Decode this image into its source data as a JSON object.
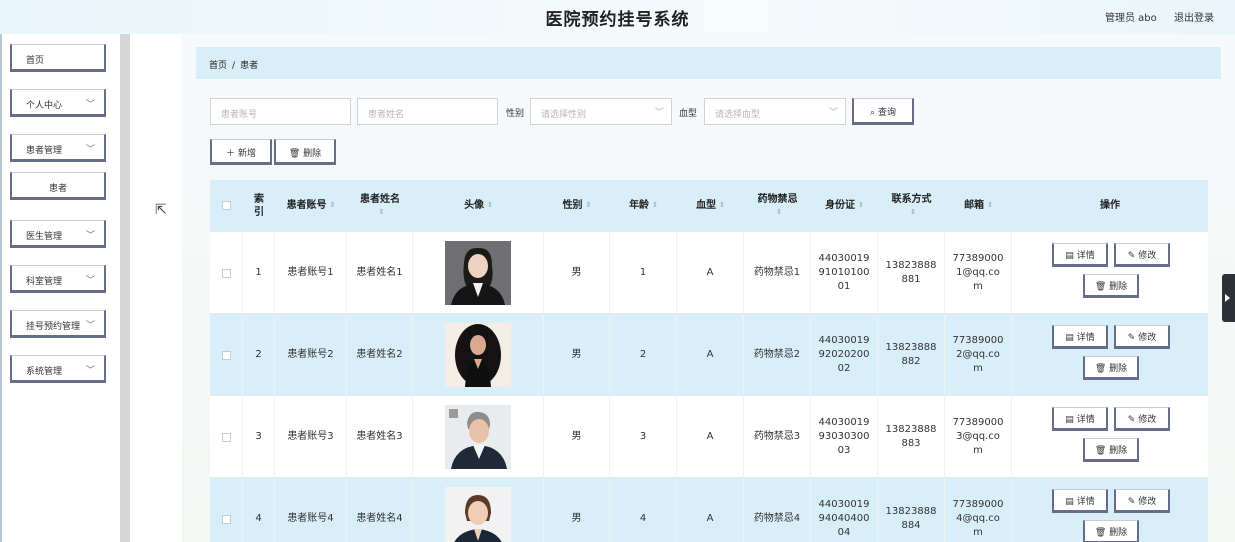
{
  "header": {
    "title": "医院预约挂号系统",
    "user": "管理员 abo",
    "logout": "退出登录"
  },
  "sidebar": {
    "items": [
      {
        "label": "首页"
      },
      {
        "label": "个人中心"
      },
      {
        "label": "患者管理"
      },
      {
        "label": "患者"
      },
      {
        "label": "医生管理"
      },
      {
        "label": "科室管理"
      },
      {
        "label": "挂号预约管理"
      },
      {
        "label": "系统管理"
      }
    ]
  },
  "breadcrumb": {
    "home": "首页",
    "sep": "/",
    "current": "患者"
  },
  "search": {
    "account_placeholder": "患者账号",
    "name_placeholder": "患者姓名",
    "gender_label": "性别",
    "gender_placeholder": "请选择性别",
    "blood_label": "血型",
    "blood_placeholder": "请选择血型",
    "query": "查询"
  },
  "actions": {
    "add": "新增",
    "delete": "删除"
  },
  "table": {
    "headers": {
      "index": "索引",
      "account": "患者账号",
      "name": "患者姓名",
      "avatar": "头像",
      "gender": "性别",
      "age": "年龄",
      "blood": "血型",
      "allergy": "药物禁忌",
      "idcard": "身份证",
      "phone": "联系方式",
      "email": "邮箱",
      "ops": "操作"
    },
    "ops": {
      "detail": "详情",
      "edit": "修改",
      "delete": "删除"
    },
    "rows": [
      {
        "index": "1",
        "account": "患者账号1",
        "name": "患者姓名1",
        "gender": "男",
        "age": "1",
        "blood": "A",
        "allergy": "药物禁忌1",
        "id1": "44030019",
        "id2": "91010100",
        "id3": "01",
        "ph1": "13823888",
        "ph2": "881",
        "em1": "77389000",
        "em2": "1@qq.co",
        "em3": "m"
      },
      {
        "index": "2",
        "account": "患者账号2",
        "name": "患者姓名2",
        "gender": "男",
        "age": "2",
        "blood": "A",
        "allergy": "药物禁忌2",
        "id1": "44030019",
        "id2": "92020200",
        "id3": "02",
        "ph1": "13823888",
        "ph2": "882",
        "em1": "77389000",
        "em2": "2@qq.co",
        "em3": "m"
      },
      {
        "index": "3",
        "account": "患者账号3",
        "name": "患者姓名3",
        "gender": "男",
        "age": "3",
        "blood": "A",
        "allergy": "药物禁忌3",
        "id1": "44030019",
        "id2": "93030300",
        "id3": "03",
        "ph1": "13823888",
        "ph2": "883",
        "em1": "77389000",
        "em2": "3@qq.co",
        "em3": "m"
      },
      {
        "index": "4",
        "account": "患者账号4",
        "name": "患者姓名4",
        "gender": "男",
        "age": "4",
        "blood": "A",
        "allergy": "药物禁忌4",
        "id1": "44030019",
        "id2": "94040400",
        "id3": "04",
        "ph1": "13823888",
        "ph2": "884",
        "em1": "77389000",
        "em2": "4@qq.co",
        "em3": "m"
      }
    ]
  }
}
